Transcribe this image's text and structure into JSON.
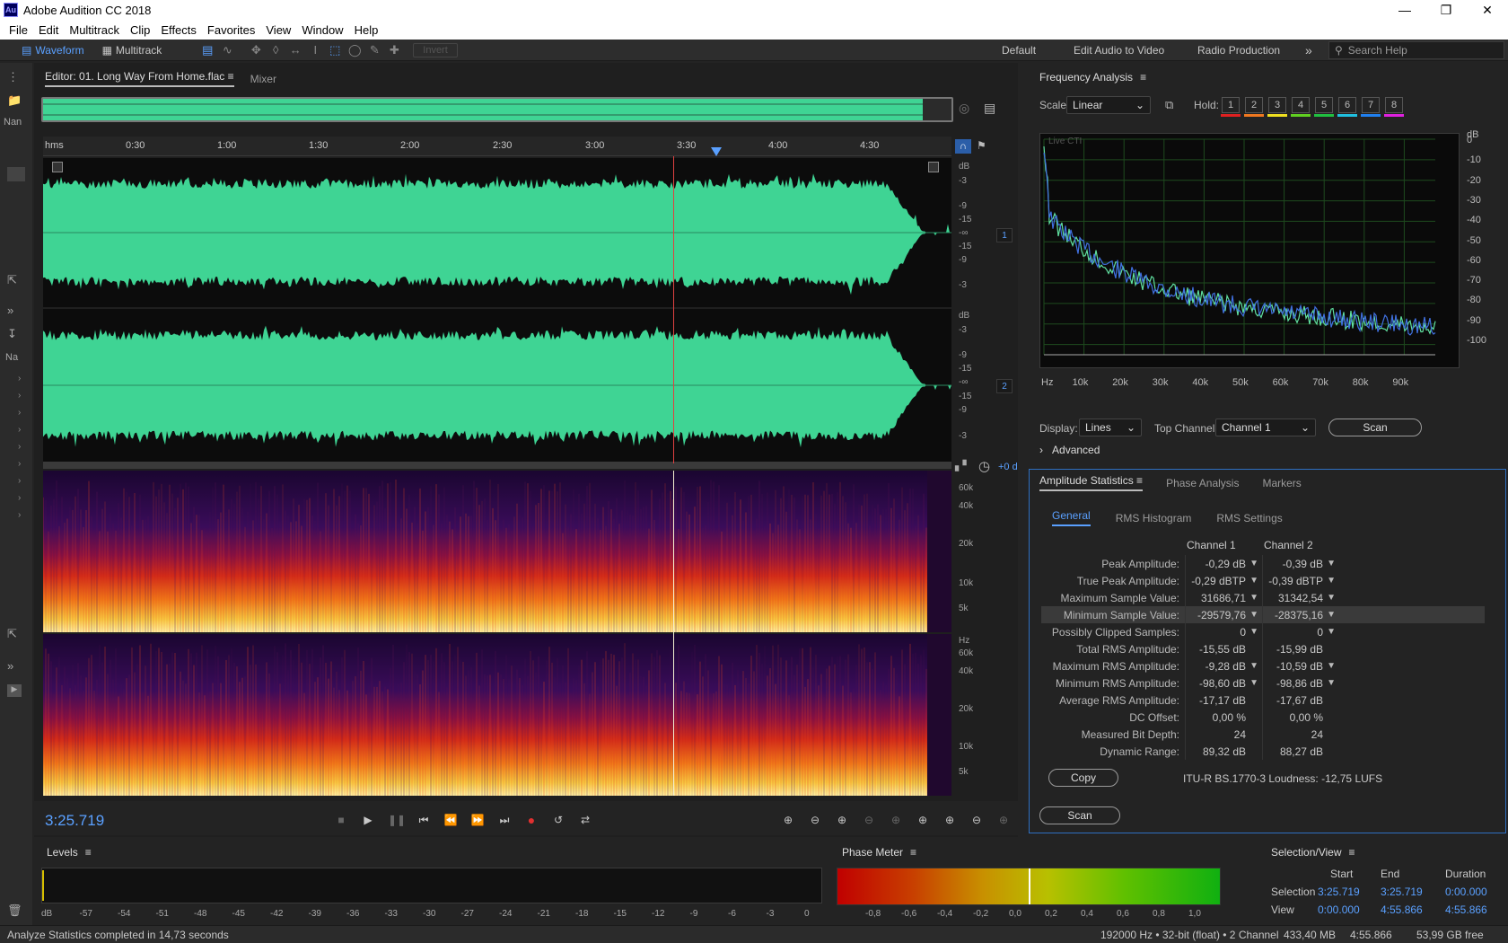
{
  "app": {
    "title": "Adobe Audition CC 2018",
    "icon_text": "Au"
  },
  "menu": [
    "File",
    "Edit",
    "Multitrack",
    "Clip",
    "Effects",
    "Favorites",
    "View",
    "Window",
    "Help"
  ],
  "toolbar": {
    "waveform_label": "Waveform",
    "multitrack_label": "Multitrack",
    "invert_label": "Invert"
  },
  "workspaces": [
    "Default",
    "Edit Audio to Video",
    "Radio Production"
  ],
  "search": {
    "placeholder": "Search Help"
  },
  "left_strip": {
    "label_nam": "Nan",
    "label_na": "Na"
  },
  "editor": {
    "tab_editor": "Editor: 01. Long Way From Home.flac",
    "tab_mixer": "Mixer",
    "time_unit": "hms",
    "ticks": [
      "0:30",
      "1:00",
      "1:30",
      "2:00",
      "2:30",
      "3:00",
      "3:30",
      "4:00",
      "4:30"
    ],
    "db_scale_1": [
      "dB",
      "-3",
      "-9",
      "-15",
      "-∞",
      "-15",
      "-9",
      "-3"
    ],
    "db_scale_2": [
      "dB",
      "-3",
      "-9",
      "-15",
      "-∞",
      "-15",
      "-9",
      "-3"
    ],
    "hz_scale_1": [
      "60k",
      "40k",
      "20k",
      "10k",
      "5k"
    ],
    "hz_scale_2": [
      "Hz",
      "60k",
      "40k",
      "20k",
      "10k",
      "5k"
    ],
    "channel_1": "1",
    "channel_2": "2",
    "pan_value": "+0 d",
    "timecode": "3:25.719",
    "waveform_color": "#3fd494",
    "playhead_color": "#e04040"
  },
  "freq": {
    "title": "Frequency Analysis",
    "scale_label": "Scale:",
    "scale_value": "Linear",
    "hold_label": "Hold:",
    "hold_slots": [
      "1",
      "2",
      "3",
      "4",
      "5",
      "6",
      "7",
      "8"
    ],
    "hold_colors": [
      "#e02020",
      "#f07820",
      "#f0e020",
      "#60d020",
      "#20c040",
      "#20c0e0",
      "#2080f0",
      "#e020e0"
    ],
    "live_label": "Live CTI",
    "db_ticks": [
      "dB",
      "0",
      "-10",
      "-20",
      "-30",
      "-40",
      "-50",
      "-60",
      "-70",
      "-80",
      "-90",
      "-100"
    ],
    "hz_ticks": [
      "Hz",
      "10k",
      "20k",
      "30k",
      "40k",
      "50k",
      "60k",
      "70k",
      "80k",
      "90k"
    ],
    "display_label": "Display:",
    "display_value": "Lines",
    "top_channel_label": "Top Channel:",
    "top_channel_value": "Channel 1",
    "scan_label": "Scan",
    "advanced_label": "Advanced",
    "series_colors": [
      "#60e0a0",
      "#4070e0"
    ]
  },
  "amp": {
    "tab_amp": "Amplitude Statistics",
    "tab_phase": "Phase Analysis",
    "tab_markers": "Markers",
    "sub_general": "General",
    "sub_hist": "RMS Histogram",
    "sub_settings": "RMS Settings",
    "col1": "Channel 1",
    "col2": "Channel 2",
    "rows": [
      {
        "label": "Peak Amplitude:",
        "c1": "-0,29 dB",
        "c2": "-0,39 dB",
        "nav": true
      },
      {
        "label": "True Peak Amplitude:",
        "c1": "-0,29 dBTP",
        "c2": "-0,39 dBTP",
        "nav": true
      },
      {
        "label": "Maximum Sample Value:",
        "c1": "31686,71",
        "c2": "31342,54",
        "nav": true
      },
      {
        "label": "Minimum Sample Value:",
        "c1": "-29579,76",
        "c2": "-28375,16",
        "nav": true
      },
      {
        "label": "Possibly Clipped Samples:",
        "c1": "0",
        "c2": "0",
        "nav": true
      },
      {
        "label": "Total RMS Amplitude:",
        "c1": "-15,55 dB",
        "c2": "-15,99 dB",
        "nav": false
      },
      {
        "label": "Maximum RMS Amplitude:",
        "c1": "-9,28 dB",
        "c2": "-10,59 dB",
        "nav": true
      },
      {
        "label": "Minimum RMS Amplitude:",
        "c1": "-98,60 dB",
        "c2": "-98,86 dB",
        "nav": true
      },
      {
        "label": "Average RMS Amplitude:",
        "c1": "-17,17 dB",
        "c2": "-17,67 dB",
        "nav": false
      },
      {
        "label": "DC Offset:",
        "c1": "0,00 %",
        "c2": "0,00 %",
        "nav": false
      },
      {
        "label": "Measured Bit Depth:",
        "c1": "24",
        "c2": "24",
        "nav": false
      },
      {
        "label": "Dynamic Range:",
        "c1": "89,32 dB",
        "c2": "88,27 dB",
        "nav": false
      }
    ],
    "copy_label": "Copy",
    "loudness": "ITU-R BS.1770-3 Loudness:  -12,75 LUFS",
    "scan_label": "Scan"
  },
  "levels": {
    "title": "Levels",
    "ticks": [
      "dB",
      "-57",
      "-54",
      "-51",
      "-48",
      "-45",
      "-42",
      "-39",
      "-36",
      "-33",
      "-30",
      "-27",
      "-24",
      "-21",
      "-18",
      "-15",
      "-12",
      "-9",
      "-6",
      "-3",
      "0"
    ]
  },
  "phase": {
    "title": "Phase Meter",
    "ticks": [
      "-0,8",
      "-0,6",
      "-0,4",
      "-0,2",
      "0,0",
      "0,2",
      "0,4",
      "0,6",
      "0,8",
      "1,0"
    ]
  },
  "selection": {
    "title": "Selection/View",
    "col_start": "Start",
    "col_end": "End",
    "col_duration": "Duration",
    "row_selection": "Selection",
    "row_view": "View",
    "sel_start": "3:25.719",
    "sel_end": "3:25.719",
    "sel_duration": "0:00.000",
    "view_start": "0:00.000",
    "view_end": "4:55.866",
    "view_duration": "4:55.866"
  },
  "status": {
    "message": "Analyze Statistics completed in 14,73 seconds",
    "format": "192000 Hz • 32-bit (float) • 2 Channel",
    "size": "433,40 MB",
    "duration": "4:55.866",
    "free": "53,99 GB free"
  }
}
